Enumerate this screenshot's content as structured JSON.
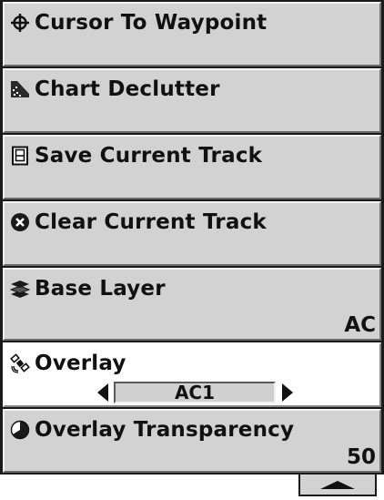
{
  "menu": {
    "items": [
      {
        "label": "Cursor To Waypoint",
        "icon": "crosshair-icon"
      },
      {
        "label": "Chart Declutter",
        "icon": "map-declutter-icon"
      },
      {
        "label": "Save Current Track",
        "icon": "save-track-icon"
      },
      {
        "label": "Clear Current Track",
        "icon": "clear-x-icon"
      },
      {
        "label": "Base Layer",
        "icon": "layers-icon",
        "value": "AC"
      },
      {
        "label": "Overlay",
        "icon": "satellite-icon",
        "value": "AC1",
        "selected": true
      },
      {
        "label": "Overlay Transparency",
        "icon": "transparency-circle-icon",
        "value": "50"
      }
    ]
  },
  "scroll": {
    "icon": "scroll-up-arrow-icon"
  }
}
